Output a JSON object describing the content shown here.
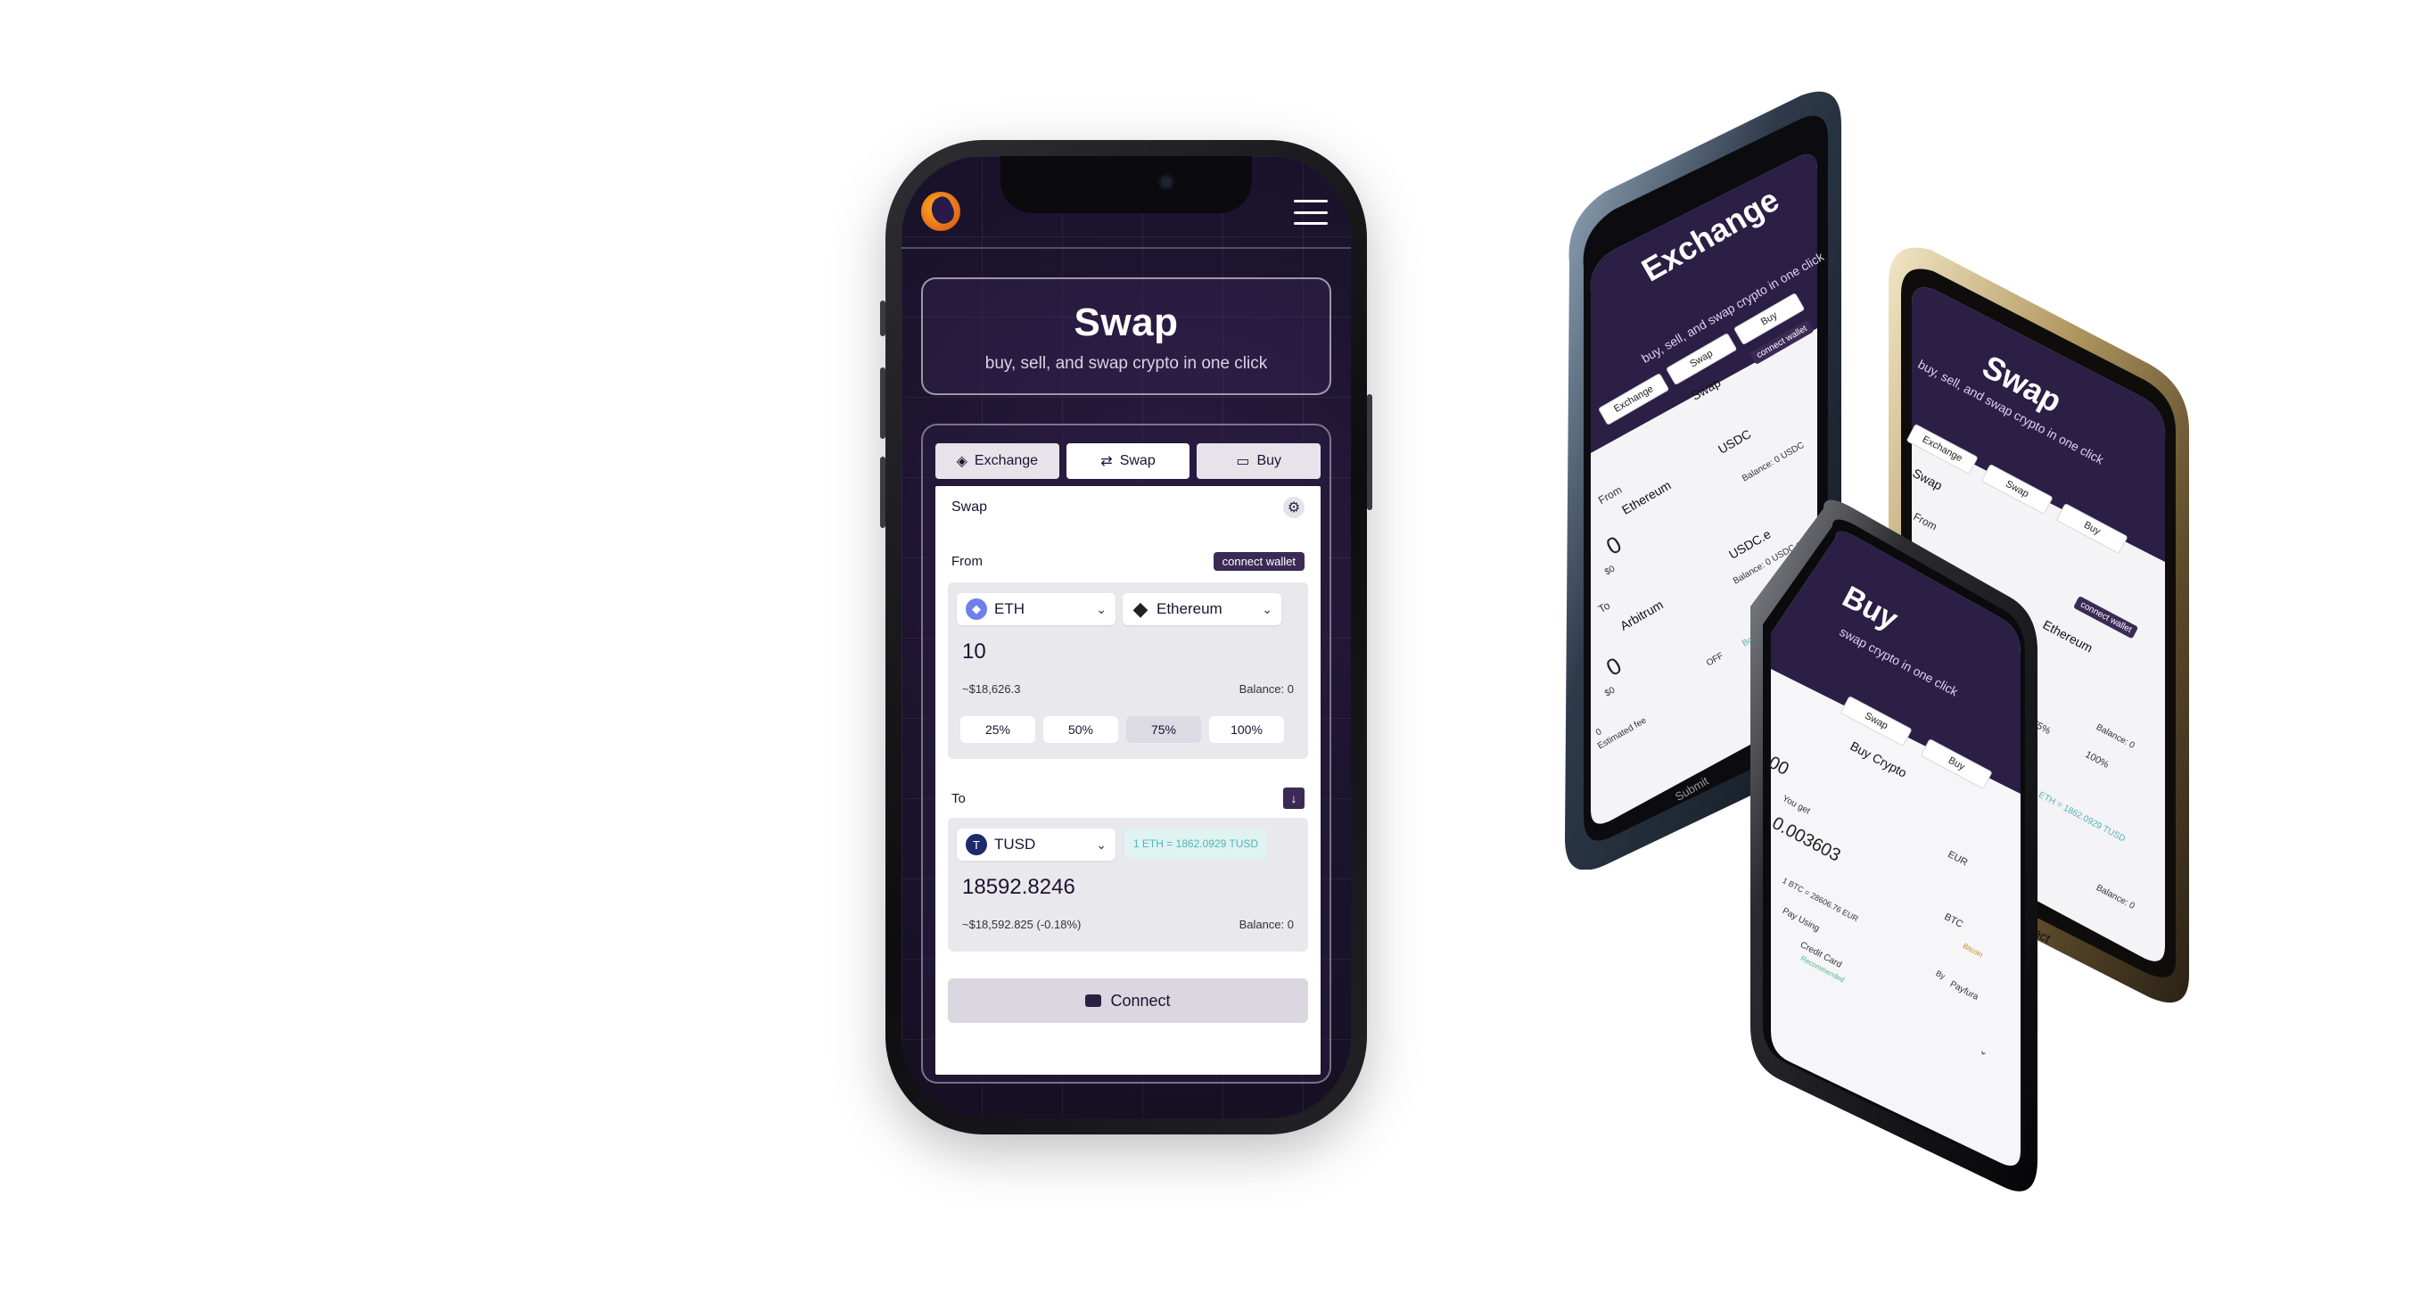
{
  "main": {
    "hero": {
      "title": "Swap",
      "subtitle": "buy, sell,  and swap crypto in one click"
    },
    "tabs": [
      {
        "label": "Exchange",
        "icon": "cube-icon"
      },
      {
        "label": "Swap",
        "icon": "swap-icon"
      },
      {
        "label": "Buy",
        "icon": "card-icon"
      }
    ],
    "panel": {
      "title": "Swap",
      "from_label": "From",
      "connect_wallet": "connect wallet",
      "from_token": "ETH",
      "from_network": "Ethereum",
      "from_amount": "10",
      "from_usd": "~$18,626.3",
      "from_balance": "Balance: 0",
      "percents": [
        "25%",
        "50%",
        "75%",
        "100%"
      ],
      "to_label": "To",
      "to_token": "TUSD",
      "rate": "1 ETH = 1862.0929 TUSD",
      "to_amount": "18592.8246",
      "to_usd": "~$18,592.825 (-0.18%)",
      "to_balance": "Balance: 0",
      "connect_button": "Connect"
    }
  },
  "phone_exchange": {
    "title": "Exchange",
    "subtitle": "buy, sell,  and swap crypto in one click",
    "tabs": [
      "Exchange",
      "Swap",
      "Buy"
    ],
    "swap_label": "Swap",
    "connect_wallet": "connect wallet",
    "from_label": "From",
    "from_network": "Ethereum",
    "from_token": "USDC",
    "balance": "Balance: 0 USDC",
    "from_amount": "0",
    "from_usd": "$0",
    "to_label": "To",
    "to_network": "Arbitrum",
    "to_token": "USDC.e",
    "to_balance": "Balance: 0 USDC.e",
    "to_amount": "0",
    "to_usd": "$0",
    "off_label": "OFF",
    "boost_label": "Boost -10s",
    "fee_label": "Estimated fee",
    "fee_value": "0",
    "submit": "Submit"
  },
  "phone_swap": {
    "title": "Swap",
    "subtitle": "buy, sell,  and swap crypto in one click",
    "tabs": [
      "Exchange",
      "Swap",
      "Buy"
    ],
    "swap_label": "Swap",
    "from_label": "From",
    "connect_wallet": "connect wallet",
    "network": "Ethereum",
    "balance1": "Balance: 0",
    "pct1": "75%",
    "pct2": "100%",
    "rate": "1 ETH = 1862.0929 TUSD",
    "balance2": "Balance: 0",
    "connect": "nnect"
  },
  "phone_buy": {
    "title": "Buy",
    "subtitle": "swap crypto in one click",
    "tabs": [
      "Swap",
      "Buy"
    ],
    "section": "Buy Crypto",
    "spend_amount": "00",
    "you_get_label": "You get",
    "you_get_value": "0.003603",
    "fiat": "EUR",
    "crypto": "BTC",
    "rate": "1 BTC = 28606.76 EUR",
    "pay_using": "Pay Using",
    "method": "Credit Card",
    "recommended": "Recommended",
    "by": "By",
    "provider": "Payfura",
    "bitcoin": "Bitcoin"
  }
}
